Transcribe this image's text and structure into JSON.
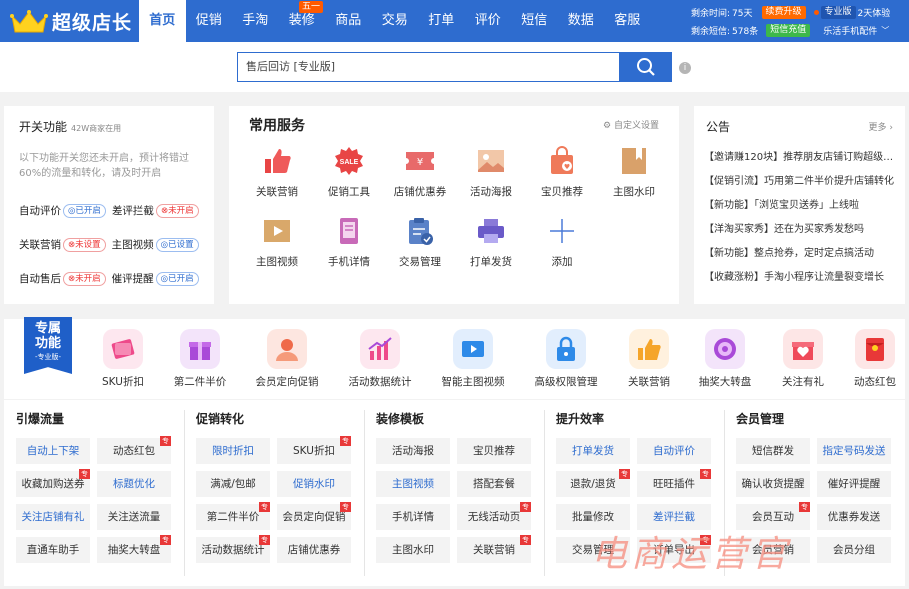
{
  "header": {
    "logo": "超级店长",
    "nav": [
      "首页",
      "促销",
      "手淘",
      "装修",
      "商品",
      "交易",
      "打单",
      "评价",
      "短信",
      "数据",
      "客服"
    ],
    "nav_badge": "五一",
    "remaining_time_label": "剩余时间:",
    "remaining_time": "75天",
    "renew_label": "续费升级",
    "version_prefix": "专业版",
    "version_suffix": "2天体验",
    "remaining_sms_label": "剩余短信:",
    "remaining_sms": "578条",
    "sms_recharge": "短信充值",
    "mobile_link": "乐活手机配件"
  },
  "search": {
    "value": "售后回访 [专业版]"
  },
  "switches": {
    "title": "开关功能",
    "subtitle": "42W商家在用",
    "desc": "以下功能开关您还未开启，预计将错过60%的流量和转化，请及时开启",
    "rows": [
      [
        {
          "name": "自动评价",
          "status": "已开启",
          "on": true
        },
        {
          "name": "差评拦截",
          "status": "未开启",
          "on": false
        }
      ],
      [
        {
          "name": "关联营销",
          "status": "未设置",
          "on": false
        },
        {
          "name": "主图视频",
          "status": "已设置",
          "on": true
        }
      ],
      [
        {
          "name": "自动售后",
          "status": "未开启",
          "on": false
        },
        {
          "name": "催评提醒",
          "status": "已开启",
          "on": true
        }
      ]
    ]
  },
  "services": {
    "title": "常用服务",
    "customize": "自定义设置",
    "items": [
      "关联营销",
      "促销工具",
      "店铺优惠券",
      "活动海报",
      "宝贝推荐",
      "主图水印",
      "主图视频",
      "手机详情",
      "交易管理",
      "打单发货",
      "添加"
    ]
  },
  "notices": {
    "title": "公告",
    "more": "更多",
    "items": [
      "【邀请赚120块】推荐朋友店铺订购超级店长",
      "【促销引流】巧用第二件半价提升店铺转化",
      "【新功能】「浏览宝贝送券」上线啦",
      "【洋淘买家秀】还在为买家秀发愁吗",
      "【新功能】整点抢券，定时定点搞活动",
      "【收藏涨粉】手淘小程序让流量裂变增长"
    ]
  },
  "exclusive": {
    "title_1": "专属",
    "title_2": "功能",
    "tag": "-专业版-",
    "items": [
      "SKU折扣",
      "第二件半价",
      "会员定向促销",
      "活动数据统计",
      "智能主图视频",
      "高级权限管理",
      "关联营销",
      "抽奖大转盘",
      "关注有礼",
      "动态红包"
    ]
  },
  "tool_columns": [
    {
      "title": "引爆流量",
      "items": [
        {
          "label": "自动上下架",
          "blue": true,
          "new": false
        },
        {
          "label": "动态红包",
          "blue": false,
          "new": true
        },
        {
          "label": "收藏加购送券",
          "blue": false,
          "new": true
        },
        {
          "label": "标题优化",
          "blue": true,
          "new": false
        },
        {
          "label": "关注店铺有礼",
          "blue": true,
          "new": false
        },
        {
          "label": "关注送流量",
          "blue": false,
          "new": false
        },
        {
          "label": "直通车助手",
          "blue": false,
          "new": false
        },
        {
          "label": "抽奖大转盘",
          "blue": false,
          "new": true
        }
      ]
    },
    {
      "title": "促销转化",
      "items": [
        {
          "label": "限时折扣",
          "blue": true,
          "new": false
        },
        {
          "label": "SKU折扣",
          "blue": false,
          "new": true
        },
        {
          "label": "满减/包邮",
          "blue": false,
          "new": false
        },
        {
          "label": "促销水印",
          "blue": true,
          "new": false
        },
        {
          "label": "第二件半价",
          "blue": false,
          "new": true
        },
        {
          "label": "会员定向促销",
          "blue": false,
          "new": true
        },
        {
          "label": "活动数据统计",
          "blue": false,
          "new": true
        },
        {
          "label": "店铺优惠券",
          "blue": false,
          "new": false
        }
      ]
    },
    {
      "title": "装修模板",
      "items": [
        {
          "label": "活动海报",
          "blue": false,
          "new": false
        },
        {
          "label": "宝贝推荐",
          "blue": false,
          "new": false
        },
        {
          "label": "主图视频",
          "blue": true,
          "new": false
        },
        {
          "label": "搭配套餐",
          "blue": false,
          "new": false
        },
        {
          "label": "手机详情",
          "blue": false,
          "new": false
        },
        {
          "label": "无线活动页",
          "blue": false,
          "new": true
        },
        {
          "label": "主图水印",
          "blue": false,
          "new": false
        },
        {
          "label": "关联营销",
          "blue": false,
          "new": true
        }
      ]
    },
    {
      "title": "提升效率",
      "items": [
        {
          "label": "打单发货",
          "blue": true,
          "new": false
        },
        {
          "label": "自动评价",
          "blue": true,
          "new": false
        },
        {
          "label": "退款/退货",
          "blue": false,
          "new": true
        },
        {
          "label": "旺旺插件",
          "blue": false,
          "new": true
        },
        {
          "label": "批量修改",
          "blue": false,
          "new": false
        },
        {
          "label": "差评拦截",
          "blue": true,
          "new": false
        },
        {
          "label": "交易管理",
          "blue": false,
          "new": false
        },
        {
          "label": "订单导出",
          "blue": false,
          "new": true
        }
      ]
    },
    {
      "title": "会员管理",
      "items": [
        {
          "label": "短信群发",
          "blue": false,
          "new": false
        },
        {
          "label": "指定号码发送",
          "blue": true,
          "new": false
        },
        {
          "label": "确认收货提醒",
          "blue": false,
          "new": false
        },
        {
          "label": "催好评提醒",
          "blue": false,
          "new": false
        },
        {
          "label": "会员互动",
          "blue": false,
          "new": true
        },
        {
          "label": "优惠券发送",
          "blue": false,
          "new": false
        },
        {
          "label": "会员营销",
          "blue": false,
          "new": false
        },
        {
          "label": "会员分组",
          "blue": false,
          "new": false
        }
      ]
    }
  ],
  "watermark": "电商运营官",
  "new_tag": "专",
  "colors": {
    "primary": "#2e6ccf",
    "danger": "#e33333",
    "orange": "#ff8a00",
    "green": "#3db84a"
  }
}
